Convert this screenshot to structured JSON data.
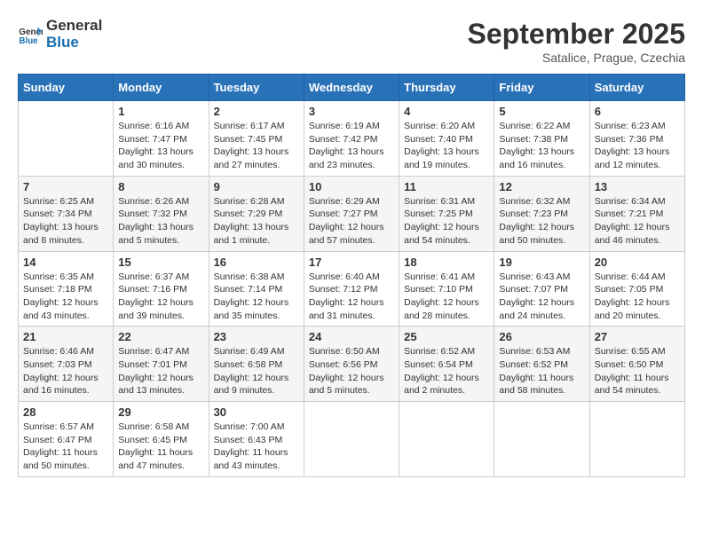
{
  "header": {
    "logo_line1": "General",
    "logo_line2": "Blue",
    "month": "September 2025",
    "location": "Satalice, Prague, Czechia"
  },
  "weekdays": [
    "Sunday",
    "Monday",
    "Tuesday",
    "Wednesday",
    "Thursday",
    "Friday",
    "Saturday"
  ],
  "weeks": [
    [
      {
        "day": "",
        "info": ""
      },
      {
        "day": "1",
        "info": "Sunrise: 6:16 AM\nSunset: 7:47 PM\nDaylight: 13 hours\nand 30 minutes."
      },
      {
        "day": "2",
        "info": "Sunrise: 6:17 AM\nSunset: 7:45 PM\nDaylight: 13 hours\nand 27 minutes."
      },
      {
        "day": "3",
        "info": "Sunrise: 6:19 AM\nSunset: 7:42 PM\nDaylight: 13 hours\nand 23 minutes."
      },
      {
        "day": "4",
        "info": "Sunrise: 6:20 AM\nSunset: 7:40 PM\nDaylight: 13 hours\nand 19 minutes."
      },
      {
        "day": "5",
        "info": "Sunrise: 6:22 AM\nSunset: 7:38 PM\nDaylight: 13 hours\nand 16 minutes."
      },
      {
        "day": "6",
        "info": "Sunrise: 6:23 AM\nSunset: 7:36 PM\nDaylight: 13 hours\nand 12 minutes."
      }
    ],
    [
      {
        "day": "7",
        "info": "Sunrise: 6:25 AM\nSunset: 7:34 PM\nDaylight: 13 hours\nand 8 minutes."
      },
      {
        "day": "8",
        "info": "Sunrise: 6:26 AM\nSunset: 7:32 PM\nDaylight: 13 hours\nand 5 minutes."
      },
      {
        "day": "9",
        "info": "Sunrise: 6:28 AM\nSunset: 7:29 PM\nDaylight: 13 hours\nand 1 minute."
      },
      {
        "day": "10",
        "info": "Sunrise: 6:29 AM\nSunset: 7:27 PM\nDaylight: 12 hours\nand 57 minutes."
      },
      {
        "day": "11",
        "info": "Sunrise: 6:31 AM\nSunset: 7:25 PM\nDaylight: 12 hours\nand 54 minutes."
      },
      {
        "day": "12",
        "info": "Sunrise: 6:32 AM\nSunset: 7:23 PM\nDaylight: 12 hours\nand 50 minutes."
      },
      {
        "day": "13",
        "info": "Sunrise: 6:34 AM\nSunset: 7:21 PM\nDaylight: 12 hours\nand 46 minutes."
      }
    ],
    [
      {
        "day": "14",
        "info": "Sunrise: 6:35 AM\nSunset: 7:18 PM\nDaylight: 12 hours\nand 43 minutes."
      },
      {
        "day": "15",
        "info": "Sunrise: 6:37 AM\nSunset: 7:16 PM\nDaylight: 12 hours\nand 39 minutes."
      },
      {
        "day": "16",
        "info": "Sunrise: 6:38 AM\nSunset: 7:14 PM\nDaylight: 12 hours\nand 35 minutes."
      },
      {
        "day": "17",
        "info": "Sunrise: 6:40 AM\nSunset: 7:12 PM\nDaylight: 12 hours\nand 31 minutes."
      },
      {
        "day": "18",
        "info": "Sunrise: 6:41 AM\nSunset: 7:10 PM\nDaylight: 12 hours\nand 28 minutes."
      },
      {
        "day": "19",
        "info": "Sunrise: 6:43 AM\nSunset: 7:07 PM\nDaylight: 12 hours\nand 24 minutes."
      },
      {
        "day": "20",
        "info": "Sunrise: 6:44 AM\nSunset: 7:05 PM\nDaylight: 12 hours\nand 20 minutes."
      }
    ],
    [
      {
        "day": "21",
        "info": "Sunrise: 6:46 AM\nSunset: 7:03 PM\nDaylight: 12 hours\nand 16 minutes."
      },
      {
        "day": "22",
        "info": "Sunrise: 6:47 AM\nSunset: 7:01 PM\nDaylight: 12 hours\nand 13 minutes."
      },
      {
        "day": "23",
        "info": "Sunrise: 6:49 AM\nSunset: 6:58 PM\nDaylight: 12 hours\nand 9 minutes."
      },
      {
        "day": "24",
        "info": "Sunrise: 6:50 AM\nSunset: 6:56 PM\nDaylight: 12 hours\nand 5 minutes."
      },
      {
        "day": "25",
        "info": "Sunrise: 6:52 AM\nSunset: 6:54 PM\nDaylight: 12 hours\nand 2 minutes."
      },
      {
        "day": "26",
        "info": "Sunrise: 6:53 AM\nSunset: 6:52 PM\nDaylight: 11 hours\nand 58 minutes."
      },
      {
        "day": "27",
        "info": "Sunrise: 6:55 AM\nSunset: 6:50 PM\nDaylight: 11 hours\nand 54 minutes."
      }
    ],
    [
      {
        "day": "28",
        "info": "Sunrise: 6:57 AM\nSunset: 6:47 PM\nDaylight: 11 hours\nand 50 minutes."
      },
      {
        "day": "29",
        "info": "Sunrise: 6:58 AM\nSunset: 6:45 PM\nDaylight: 11 hours\nand 47 minutes."
      },
      {
        "day": "30",
        "info": "Sunrise: 7:00 AM\nSunset: 6:43 PM\nDaylight: 11 hours\nand 43 minutes."
      },
      {
        "day": "",
        "info": ""
      },
      {
        "day": "",
        "info": ""
      },
      {
        "day": "",
        "info": ""
      },
      {
        "day": "",
        "info": ""
      }
    ]
  ]
}
